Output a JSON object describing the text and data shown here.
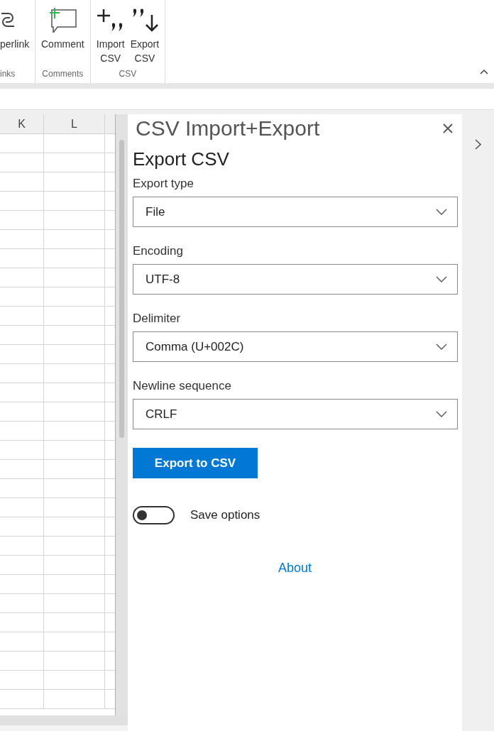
{
  "ribbon": {
    "groups": [
      {
        "label": "inks",
        "buttons": [
          {
            "kind": "link",
            "label": "perlink"
          }
        ]
      },
      {
        "label": "Comments",
        "buttons": [
          {
            "kind": "comment",
            "label": "Comment"
          }
        ]
      },
      {
        "label": "CSV",
        "buttons": [
          {
            "kind": "import",
            "label": "Import\nCSV"
          },
          {
            "kind": "export",
            "label": "Export\nCSV"
          }
        ]
      }
    ]
  },
  "sheet": {
    "columns": [
      "K",
      "L"
    ]
  },
  "pane": {
    "title": "CSV Import+Export",
    "heading": "Export CSV",
    "fields": [
      {
        "label": "Export type",
        "value": "File"
      },
      {
        "label": "Encoding",
        "value": "UTF-8"
      },
      {
        "label": "Delimiter",
        "value": "Comma (U+002C)"
      },
      {
        "label": "Newline sequence",
        "value": "CRLF"
      }
    ],
    "button": "Export to CSV",
    "toggle": {
      "label": "Save options",
      "on": false
    },
    "link": "About"
  }
}
